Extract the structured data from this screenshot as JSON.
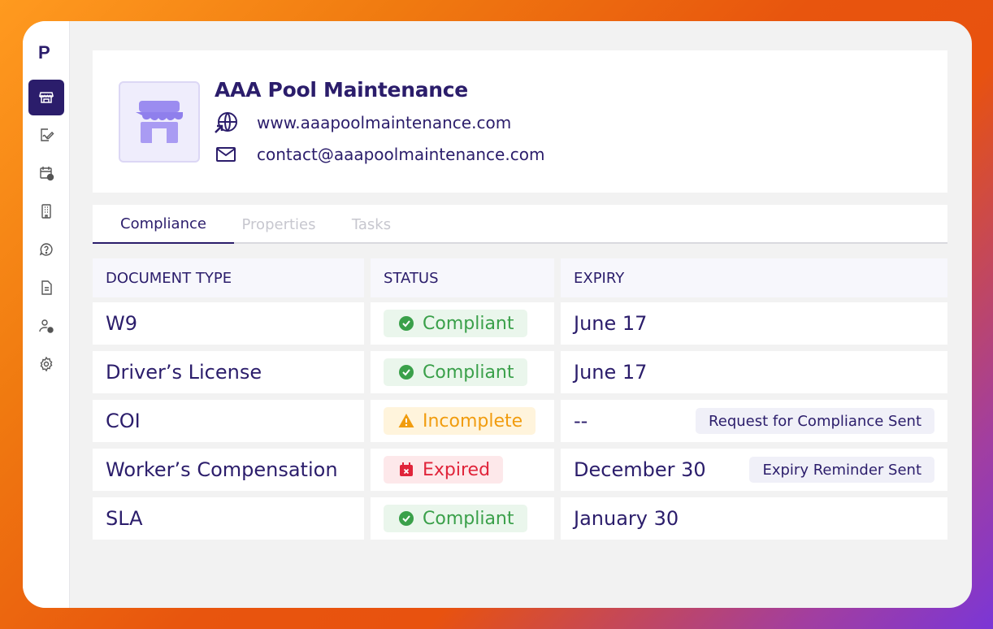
{
  "app": {
    "logo_letter": "P"
  },
  "sidebar": {
    "items": [
      {
        "icon": "storefront-icon",
        "active": true
      },
      {
        "icon": "document-edit-icon"
      },
      {
        "icon": "calendar-clock-icon"
      },
      {
        "icon": "building-icon"
      },
      {
        "icon": "help-chat-icon"
      },
      {
        "icon": "file-icon"
      },
      {
        "icon": "user-clock-icon"
      },
      {
        "icon": "gear-icon"
      }
    ]
  },
  "vendor": {
    "name": "AAA Pool Maintenance",
    "website": "www.aaapoolmaintenance.com",
    "email": "contact@aaapoolmaintenance.com"
  },
  "tabs": [
    "Compliance",
    "Properties",
    "Tasks"
  ],
  "table": {
    "headers": [
      "DOCUMENT TYPE",
      "STATUS",
      "EXPIRY"
    ],
    "rows": [
      {
        "doc": "W9",
        "status": "Compliant",
        "expiry": "June 17",
        "note": ""
      },
      {
        "doc": "Driver’s License",
        "status": "Compliant",
        "expiry": "June 17",
        "note": ""
      },
      {
        "doc": "COI",
        "status": "Incomplete",
        "expiry": "--",
        "note": "Request for Compliance Sent"
      },
      {
        "doc": "Worker’s Compensation",
        "status": "Expired",
        "expiry": "December 30",
        "note": "Expiry Reminder Sent"
      },
      {
        "doc": "SLA",
        "status": "Compliant",
        "expiry": "January 30",
        "note": ""
      }
    ]
  },
  "colors": {
    "brand": "#2b1d6b",
    "compliant": "#3aa04a",
    "incomplete": "#f19c0e",
    "expired": "#e0243a"
  }
}
